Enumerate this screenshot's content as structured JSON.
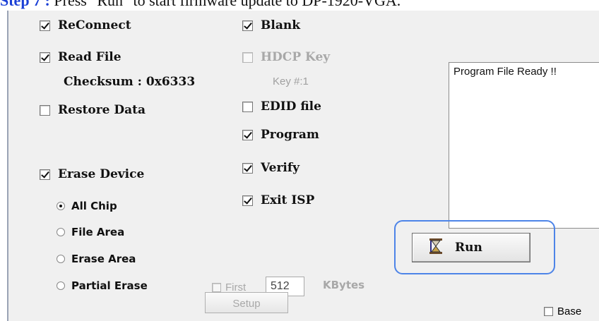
{
  "caption": {
    "step": "Step 7 :",
    "text": " Press \"Run\" to start firmware update to DP-1920-VGA."
  },
  "left_checks": {
    "reconnect": {
      "label": "ReConnect",
      "checked": true
    },
    "read_file": {
      "label": "Read File",
      "checked": true
    },
    "checksum": "Checksum : 0x6333",
    "restore_data": {
      "label": "Restore Data",
      "checked": false
    },
    "erase_device": {
      "label": "Erase Device",
      "checked": true
    }
  },
  "erase_options": {
    "all_chip": "All Chip",
    "file_area": "File Area",
    "erase_area": "Erase Area",
    "partial_erase": "Partial Erase",
    "selected": "All Chip"
  },
  "right_checks": {
    "blank": {
      "label": "Blank",
      "checked": true
    },
    "hdcp_key": {
      "label": "HDCP Key",
      "checked": false,
      "disabled": true
    },
    "key_num": "Key #:1",
    "edid_file": {
      "label": "EDID file",
      "checked": false
    },
    "program": {
      "label": "Program",
      "checked": true
    },
    "verify": {
      "label": "Verify",
      "checked": true
    },
    "exit_isp": {
      "label": "Exit ISP",
      "checked": true
    }
  },
  "partial": {
    "first_label": "First",
    "size_value": "512",
    "unit": "KBytes",
    "setup_label": "Setup"
  },
  "status": {
    "message": "Program File Ready !!"
  },
  "run": {
    "label": "Run",
    "icon": "hourglass-icon"
  },
  "base": {
    "label": "Base"
  },
  "colors": {
    "highlight": "#4d84e8",
    "step": "#1a3fd6"
  }
}
